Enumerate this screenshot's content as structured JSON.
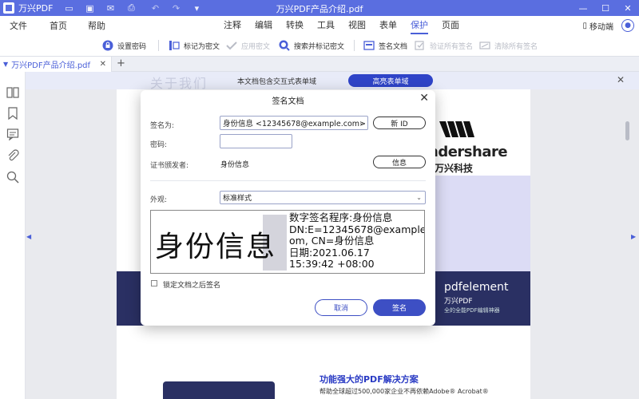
{
  "titlebar": {
    "app_name": "万兴PDF",
    "title": "万兴PDF产品介绍.pdf",
    "win_min": "—",
    "win_max": "☐",
    "win_close": "✕"
  },
  "menubar": {
    "left": [
      "文件",
      "首页",
      "帮助"
    ],
    "center": [
      "注释",
      "编辑",
      "转换",
      "工具",
      "视图",
      "表单",
      "保护",
      "页面"
    ],
    "active": "保护",
    "mobile": "移动端"
  },
  "toolbar": {
    "set_password": "设置密码",
    "mark_redact": "标记为密文",
    "apply_redact": "应用密文",
    "search_redact": "搜索并标记密文",
    "sign_doc": "签名文档",
    "verify_all": "验证所有签名",
    "clear_all": "清除所有签名"
  },
  "tabs": {
    "doc_tab": "万兴PDF产品介绍.pdf",
    "close": "✕",
    "new": "+"
  },
  "notice": {
    "ghost_text": "关于我们",
    "message": "本文档包含交互式表单域",
    "highlight_button": "高亮表单域",
    "close": "✕"
  },
  "document": {
    "brand_line1": "ndershare",
    "brand_line2": "万兴科技",
    "product": "pdfelement",
    "product_cn": "万兴PDF",
    "product_tag": "全的全能PDF编辑神器",
    "heading": "功能强大的PDF解决方案",
    "subheading": "帮助全球超过500,000家企业不再依赖Adobe® Acrobat®"
  },
  "dialog": {
    "title": "签名文档",
    "close": "✕",
    "sign_as_label": "签名为:",
    "sign_as_value": "身份信息 <12345678@example.com>",
    "new_id_button": "新 ID",
    "password_label": "密码:",
    "password_value": "",
    "issuer_label": "证书颁发者:",
    "issuer_value": "身份信息",
    "info_button": "信息",
    "appearance_label": "外观:",
    "appearance_value": "标准样式",
    "preview_name": "身份信息",
    "preview_lines": [
      "数字签名程序:身份信息",
      "DN:E=12345678@example.c",
      "om, CN=身份信息",
      "日期:2021.06.17",
      " 15:39:42 +08:00"
    ],
    "lock_label": "锁定文档之后签名",
    "cancel_button": "取消",
    "sign_button": "签名"
  }
}
